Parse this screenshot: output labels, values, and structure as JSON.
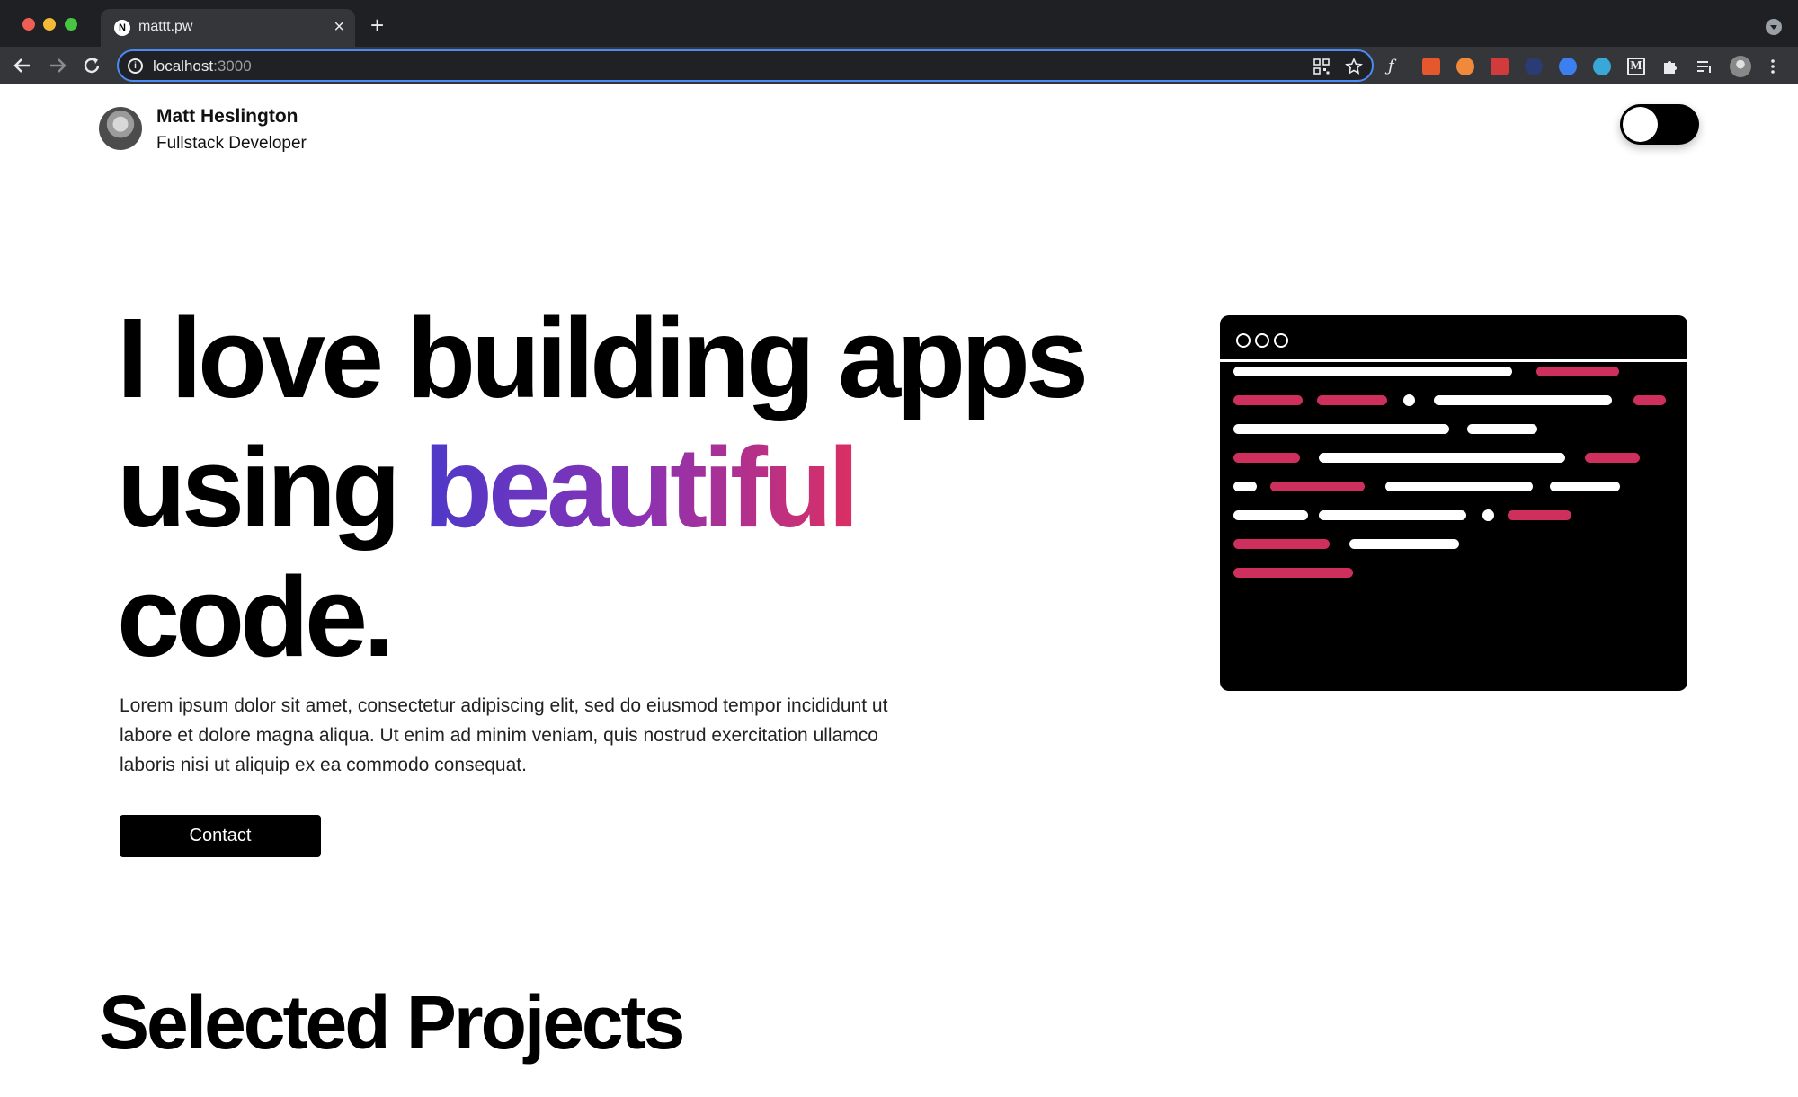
{
  "browser": {
    "tab_title": "mattt.pw",
    "tab_favicon": "N",
    "tab_close": "×",
    "new_tab": "+",
    "url_host": "localhost",
    "url_port": ":3000",
    "info_icon": "i",
    "accent": "#4c8bf5",
    "extension_icons": [
      "function-icon",
      "orange-percent-icon",
      "squirrel-icon",
      "red-calendar-icon",
      "dark-circle-icon",
      "blue-circle-icon",
      "blue-shield-icon",
      "medium-icon",
      "puzzle-icon",
      "reading-list-icon",
      "profile-avatar-icon",
      "kebab-menu-icon"
    ]
  },
  "header": {
    "name": "Matt Heslington",
    "role": "Fullstack Developer"
  },
  "hero": {
    "line1": "I love building apps",
    "line2_prefix": "using ",
    "line2_highlight": "beautiful",
    "line3": "code.",
    "gradient": [
      "#4d39c9",
      "#8a32b4",
      "#db2f63"
    ],
    "paragraph": "Lorem ipsum dolor sit amet, consectetur adipiscing elit, sed do eiusmod tempor incididunt ut labore et dolore magna aliqua. Ut enim ad minim veniam, quis nostrud exercitation ullamco laboris nisi ut aliquip ex ea commodo consequat.",
    "contact_label": "Contact"
  },
  "projects": {
    "title": "Selected Projects"
  },
  "colors": {
    "code_accent": "#cf2f5c",
    "page_bg": "#ffffff",
    "text": "#000000"
  }
}
